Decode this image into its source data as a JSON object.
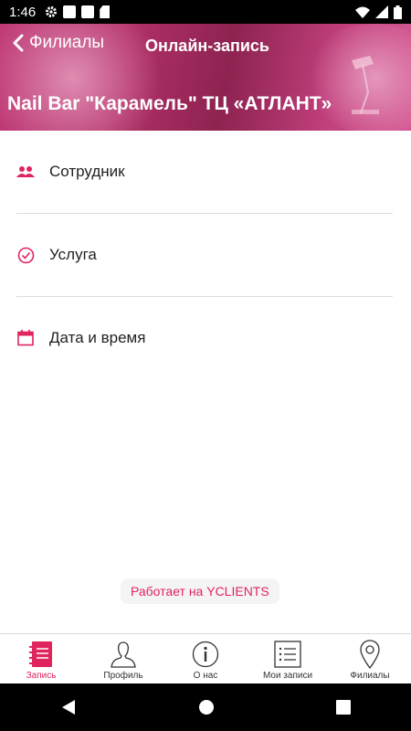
{
  "status": {
    "time": "1:46"
  },
  "header": {
    "back_label": "Филиалы",
    "title": "Онлайн-запись",
    "branch": "Nail Bar \"Карамель\" ТЦ «АТЛАНТ»"
  },
  "menu": [
    {
      "label": "Сотрудник",
      "icon": "users-icon"
    },
    {
      "label": "Услуга",
      "icon": "check-circle-icon"
    },
    {
      "label": "Дата и время",
      "icon": "calendar-icon"
    }
  ],
  "powered_by": "Работает на YCLIENTS",
  "tabs": [
    {
      "label": "Запись",
      "icon": "notepad-icon",
      "active": true
    },
    {
      "label": "Профиль",
      "icon": "person-icon"
    },
    {
      "label": "О нас",
      "icon": "info-icon"
    },
    {
      "label": "Мои записи",
      "icon": "list-icon"
    },
    {
      "label": "Филиалы",
      "icon": "location-pin-icon"
    }
  ],
  "colors": {
    "accent": "#e0245e",
    "header": "#b23068"
  }
}
